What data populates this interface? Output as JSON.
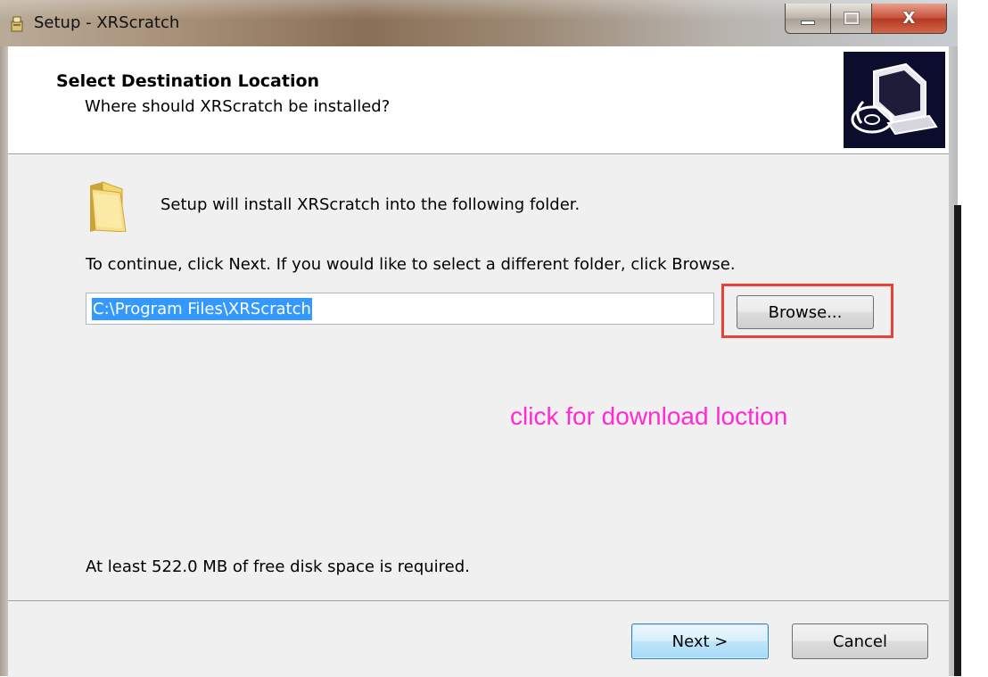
{
  "window": {
    "title": "Setup - XRScratch",
    "icon": "setup-icon",
    "controls": [
      "minimize-icon",
      "maximize-icon",
      "close-icon"
    ]
  },
  "header": {
    "title": "Select Destination Location",
    "subtitle": "Where should XRScratch be installed?",
    "image": "computer-install-image"
  },
  "main": {
    "folder_icon": "folder-icon",
    "install_text": "Setup will install XRScratch into the following folder.",
    "continue_text": "To continue, click Next. If you would like to select a different folder, click Browse.",
    "path_value": "C:\\Program Files\\XRScratch",
    "browse_label": "Browse...",
    "annotation": "click for download loction",
    "disk_space_text": "At least 522.0 MB of free disk space is required."
  },
  "footer": {
    "next_label": "Next >",
    "cancel_label": "Cancel"
  },
  "colors": {
    "annotation": "#ff2ad4",
    "highlight_box": "#e8413a",
    "selection": "#3399ff"
  }
}
